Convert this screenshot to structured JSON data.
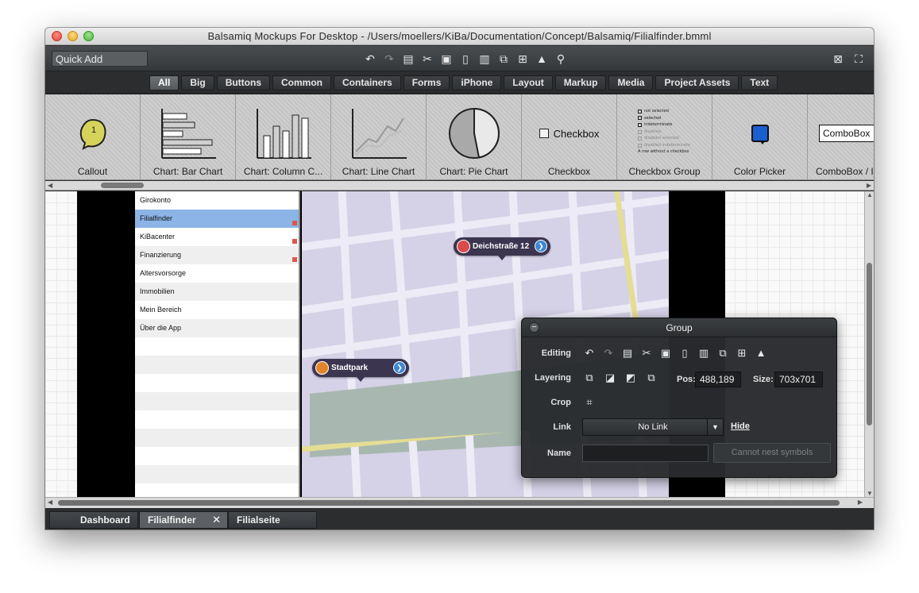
{
  "window": {
    "title": "Balsamiq Mockups For Desktop - /Users/moellers/KiBa/Documentation/Concept/Balsamiq/Filialfinder.bmml"
  },
  "toolbar": {
    "quick_add_value": "Quick Add",
    "icons": [
      "undo-icon",
      "redo-icon",
      "copy-icon",
      "cut-icon",
      "paste-icon",
      "clipboard-icon",
      "trash-icon",
      "group-icon",
      "ungroup-icon",
      "lock-icon",
      "search-icon"
    ],
    "right_icons": [
      "close-square-icon",
      "fullscreen-icon"
    ]
  },
  "filter_tabs": [
    "All",
    "Big",
    "Buttons",
    "Common",
    "Containers",
    "Forms",
    "iPhone",
    "Layout",
    "Markup",
    "Media",
    "Project Assets",
    "Text"
  ],
  "library": {
    "items": [
      {
        "label": "Callout"
      },
      {
        "label": "Chart: Bar Chart"
      },
      {
        "label": "Chart: Column C..."
      },
      {
        "label": "Chart: Line Chart"
      },
      {
        "label": "Chart: Pie Chart"
      },
      {
        "label": "Checkbox"
      },
      {
        "label": "Checkbox Group"
      },
      {
        "label": "Color Picker"
      },
      {
        "label": "ComboBox / I"
      }
    ],
    "callout_number": "1",
    "checkbox_text": "Checkbox",
    "checkbox_group_lines": [
      "not selected",
      "selected",
      "indeterminate",
      "disabled",
      "disabled selected",
      "disabled indeterminate",
      "A row without a checkbox"
    ],
    "combobox_text": "ComboBox"
  },
  "mockup": {
    "menu_items": [
      "Girokonto",
      "Filialfinder",
      "KiBacenter",
      "Finanzierung",
      "Altersvorsorge",
      "Immobilien",
      "Mein Bereich",
      "Über die App"
    ],
    "pins": [
      {
        "label": "Deichstraße 12"
      },
      {
        "label": "Stadtpark"
      }
    ]
  },
  "group_panel": {
    "title": "Group",
    "editing_label": "Editing",
    "layering_label": "Layering",
    "crop_label": "Crop",
    "link_label": "Link",
    "name_label": "Name",
    "pos_label": "Pos:",
    "pos_value": "488,189",
    "size_label": "Size:",
    "size_value": "703x701",
    "link_value": "No Link",
    "hide_link": "Hide",
    "name_value": "",
    "nest_button": "Cannot nest symbols"
  },
  "doc_tabs": [
    {
      "label": "Dashboard"
    },
    {
      "label": "Filialfinder"
    },
    {
      "label": "Filialseite"
    }
  ]
}
